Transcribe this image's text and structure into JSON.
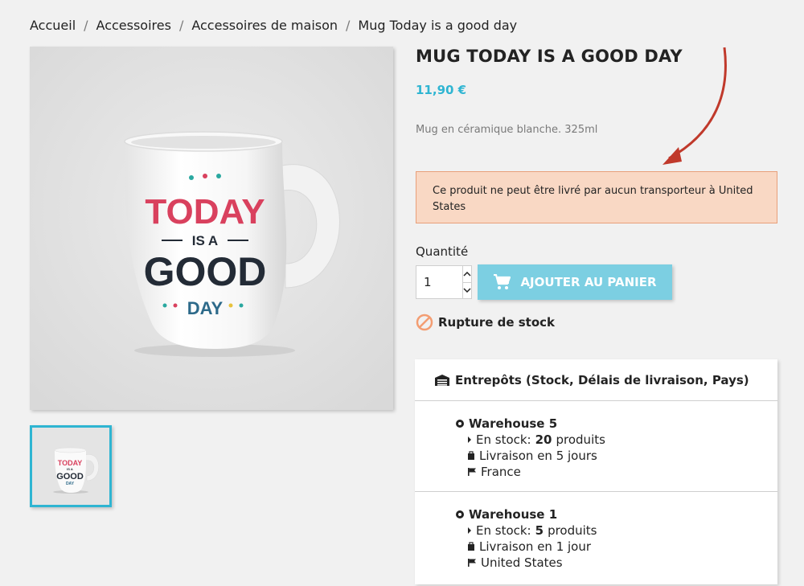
{
  "breadcrumb": {
    "items": [
      "Accueil",
      "Accessoires",
      "Accessoires de maison",
      "Mug Today is a good day"
    ],
    "separator": "/"
  },
  "product": {
    "title": "MUG TODAY IS A GOOD DAY",
    "price": "11,90 €",
    "description": "Mug en céramique blanche. 325ml",
    "mug_text": {
      "line1": "TODAY",
      "line2": "IS A",
      "line3": "GOOD",
      "line4": "DAY"
    }
  },
  "alert": {
    "text": "Ce produit ne peut être livré par aucun transporteur à United States"
  },
  "quantity": {
    "label": "Quantité",
    "value": "1"
  },
  "add_to_cart": {
    "label": "AJOUTER AU PANIER"
  },
  "stock_status": {
    "label": "Rupture de stock"
  },
  "warehouses": {
    "header": "Entrepôts (Stock, Délais de livraison, Pays)",
    "items": [
      {
        "name": "Warehouse 5",
        "stock_prefix": "En stock:",
        "stock_qty": "20",
        "stock_suffix": "produits",
        "delivery": "Livraison en 5 jours",
        "country": "France"
      },
      {
        "name": "Warehouse 1",
        "stock_prefix": "En stock:",
        "stock_qty": "5",
        "stock_suffix": "produits",
        "delivery": "Livraison en 1 jour",
        "country": "United States"
      }
    ]
  },
  "colors": {
    "accent": "#2fb5d2",
    "button": "#7ccfe2",
    "alert_bg": "#f9d8c4",
    "alert_border": "#e8a07a",
    "arrow": "#c0392b",
    "mug_red": "#d9415e",
    "mug_dark": "#232b36",
    "mug_blue": "#2d6a8a"
  }
}
